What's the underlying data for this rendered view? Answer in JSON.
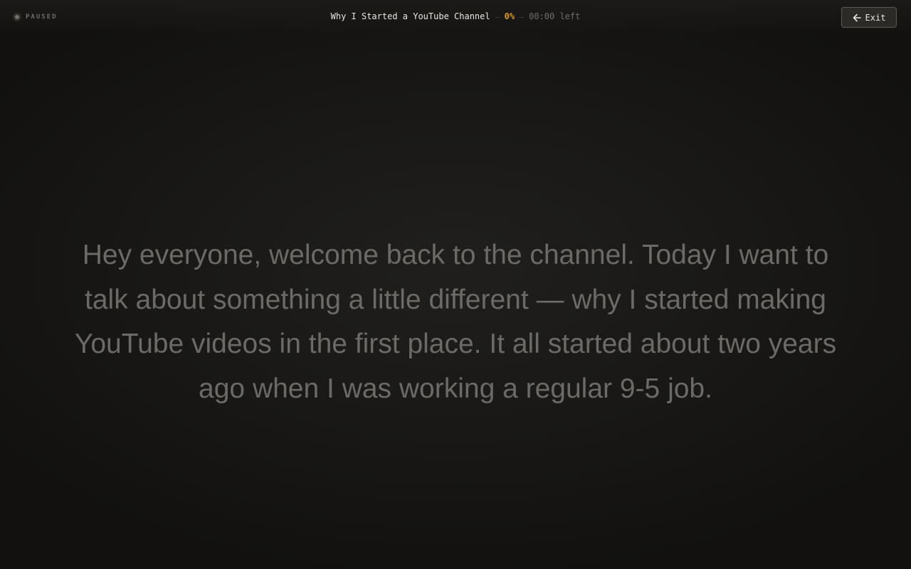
{
  "status": {
    "label": "PAUSED",
    "icon": "status-dot-icon"
  },
  "header": {
    "title": "Why I Started a YouTube Channel",
    "separator": "—",
    "progress": "0%",
    "time_left": "00:00 left",
    "accent_color": "#d99a2b"
  },
  "exit_button": {
    "label": "Exit",
    "icon": "arrow-left-icon"
  },
  "script": {
    "text": "Hey everyone, welcome back to the channel. Today I want to talk about something a little different — why I started making YouTube videos in the first place. It all started about two years ago when I was working a regular 9-5 job."
  }
}
